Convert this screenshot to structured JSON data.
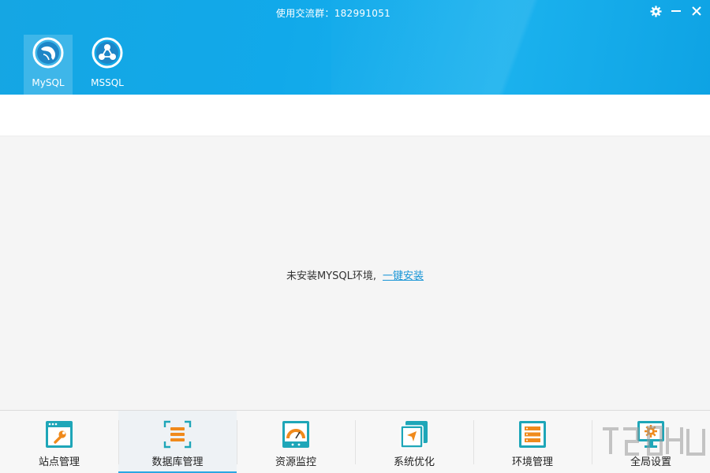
{
  "window": {
    "title": "使用交流群：182991051",
    "controls": {
      "settings_icon": "gear-icon",
      "minimize_icon": "minimize-icon",
      "close_icon": "close-icon"
    }
  },
  "db_tabs": [
    {
      "label": "MySQL",
      "icon": "dolphin-icon",
      "active": true
    },
    {
      "label": "MSSQL",
      "icon": "network-nodes-icon",
      "active": false
    }
  ],
  "content": {
    "message": "未安装MYSQL环境,",
    "install_link": "一键安装"
  },
  "bottom_nav": [
    {
      "label": "站点管理",
      "icon": "wrench-window-icon",
      "active": false
    },
    {
      "label": "数据库管理",
      "icon": "database-list-icon",
      "active": true
    },
    {
      "label": "资源监控",
      "icon": "gauge-icon",
      "active": false
    },
    {
      "label": "系统优化",
      "icon": "cursor-arrow-icon",
      "active": false
    },
    {
      "label": "环境管理",
      "icon": "server-rack-icon",
      "active": false
    },
    {
      "label": "全局设置",
      "icon": "monitor-gear-icon",
      "active": false
    }
  ],
  "colors": {
    "header_blue": "#15a6e3",
    "link_blue": "#1795d6",
    "active_underline": "#2aa7e2",
    "content_bg": "#f5f5f5"
  }
}
